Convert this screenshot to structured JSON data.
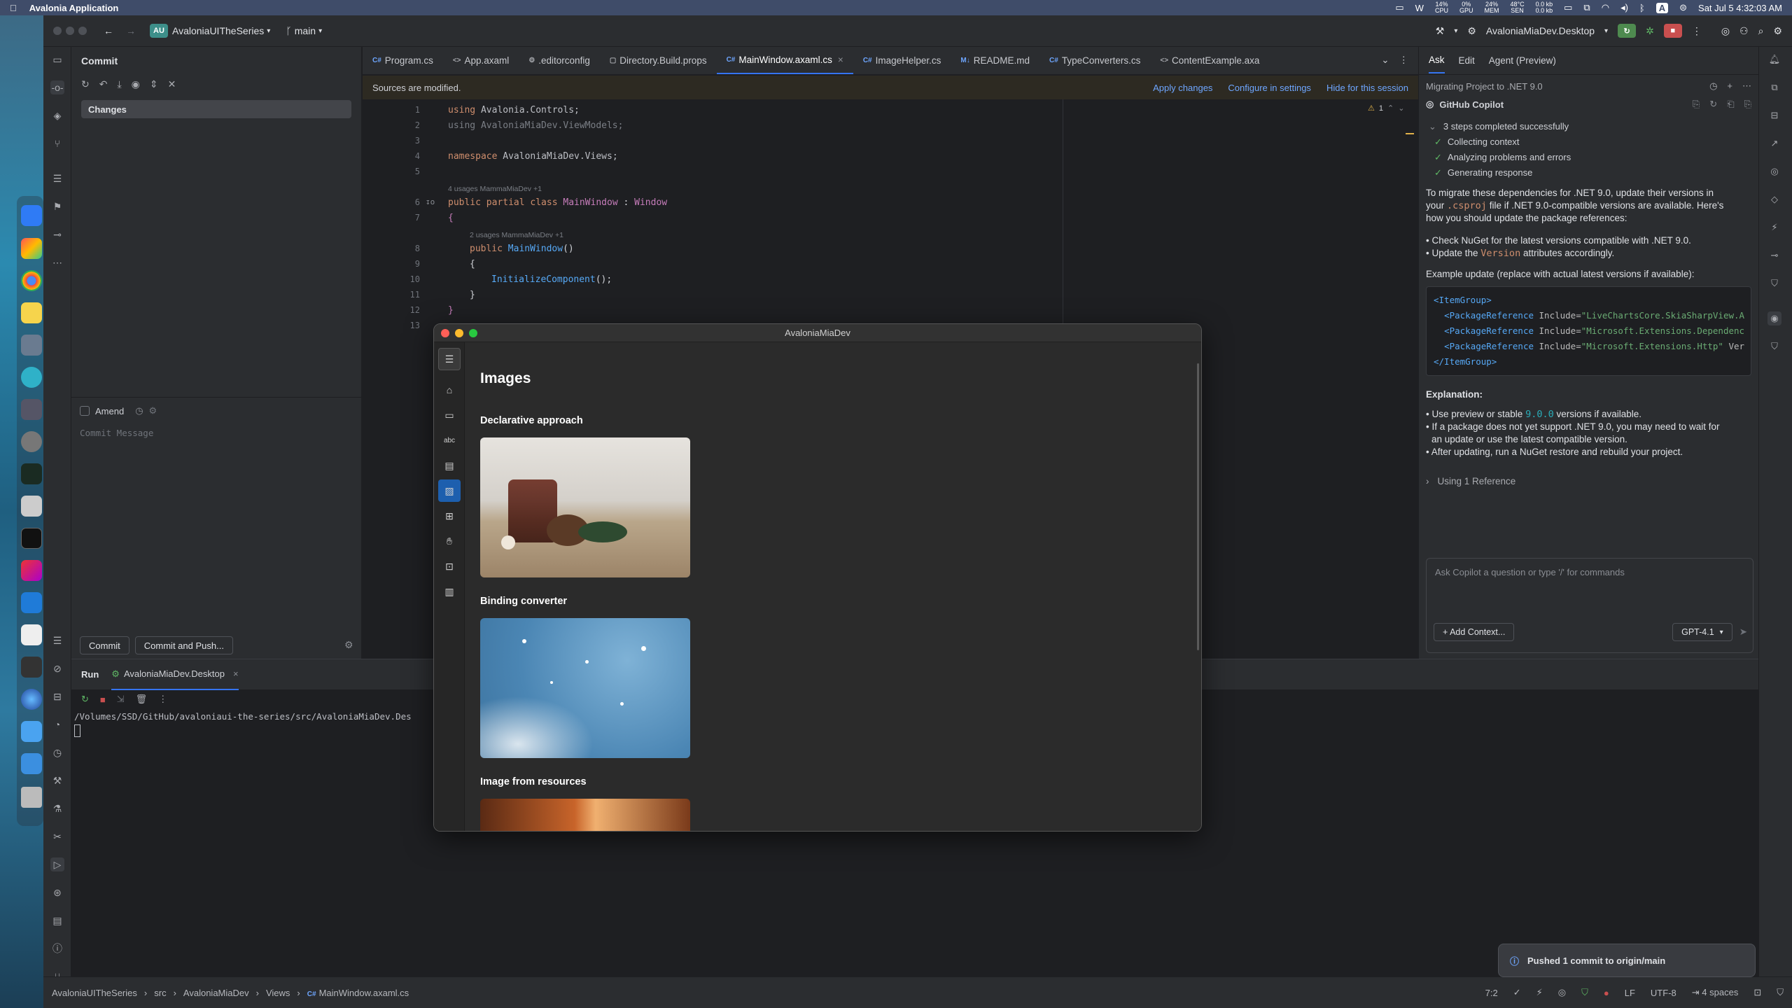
{
  "menubar": {
    "app_name": "Avalonia Application",
    "stats": [
      {
        "v": "14%",
        "l": "CPU"
      },
      {
        "v": "0%",
        "l": "GPU"
      },
      {
        "v": "24%",
        "l": "MEM"
      },
      {
        "v": "48°C",
        "l": "SEN"
      },
      {
        "v": "0.0 kb",
        "l": "0.0 kb"
      }
    ],
    "input_badge": "A",
    "datetime": "Sat Jul 5  4:32:03 AM"
  },
  "ide": {
    "project_badge": "AU",
    "project_name": "AvaloniaUITheSeries",
    "branch": "main",
    "run_config": "AvaloniaMiaDev.Desktop",
    "commit_panel": {
      "title": "Commit",
      "changes_label": "Changes",
      "amend_label": "Amend",
      "commit_message_placeholder": "Commit Message",
      "commit_button": "Commit",
      "commit_push_button": "Commit and Push..."
    },
    "tabs": [
      {
        "prefix": "C#",
        "label": "Program.cs",
        "color": "#6ea6ff"
      },
      {
        "prefix": "<>",
        "label": "App.axaml",
        "color": "#a9abb0"
      },
      {
        "prefix": "⚙",
        "label": ".editorconfig",
        "color": "#a9abb0"
      },
      {
        "prefix": "▢",
        "label": "Directory.Build.props",
        "color": "#a9abb0"
      },
      {
        "prefix": "C#",
        "label": "MainWindow.axaml.cs",
        "color": "#6ea6ff",
        "active": true
      },
      {
        "prefix": "C#",
        "label": "ImageHelper.cs",
        "color": "#6ea6ff"
      },
      {
        "prefix": "M↓",
        "label": "README.md",
        "color": "#6ea6ff"
      },
      {
        "prefix": "C#",
        "label": "TypeConverters.cs",
        "color": "#6ea6ff"
      },
      {
        "prefix": "<>",
        "label": "ContentExample.axa",
        "color": "#a9abb0"
      }
    ],
    "notice": {
      "text": "Sources are modified.",
      "apply": "Apply changes",
      "configure": "Configure in settings",
      "hide": "Hide for this session"
    },
    "warnings": "1",
    "code": {
      "line_numbers": [
        "1",
        "2",
        "3",
        "4",
        "5",
        "6",
        "7",
        "8",
        "9",
        "10",
        "11",
        "12",
        "13"
      ],
      "l1_kw": "using",
      "l1_ns": "Avalonia.Controls;",
      "l2": "using AvaloniaMiaDev.ViewModels;",
      "l4_kw": "namespace",
      "l4_ns": "AvaloniaMiaDev.Views;",
      "hint1_usages": "4 usages",
      "hint1_author": "MammaMiaDev +1",
      "l6_kw": "public partial class",
      "l6_ty": "MainWindow",
      "l6_sep": " : ",
      "l6_base": "Window",
      "l7": "{",
      "hint2_usages": "2 usages",
      "hint2_author": "MammaMiaDev +1",
      "l8_kw": "public",
      "l8_fn": "MainWindow",
      "l8_rest": "()",
      "l9": "{",
      "l10_fn": "InitializeComponent",
      "l10_rest": "();",
      "l11": "}",
      "l12": "}"
    },
    "copilot": {
      "tabs": [
        "Ask",
        "Edit",
        "Agent (Preview)"
      ],
      "session_title": "Migrating Project to .NET 9.0",
      "author": "GitHub Copilot",
      "steps_summary": "3 steps completed successfully",
      "steps": [
        "Collecting context",
        "Analyzing problems and errors",
        "Generating response"
      ],
      "intro_1": "To migrate these dependencies for .NET 9.0, update their versions in",
      "intro_2a": "your",
      "intro_2code": ".csproj",
      "intro_2b": "file if .NET 9.0-compatible versions are available. Here's",
      "intro_3": "how you should update the package references:",
      "bullet_1": "• Check NuGet for the latest versions compatible with .NET 9.0.",
      "bullet_2a": "• Update the",
      "bullet_2code": "Version",
      "bullet_2b": "attributes accordingly.",
      "example_label": "Example update (replace with actual latest versions if available):",
      "code_open": "<ItemGroup>",
      "pkg_tag": "<PackageReference",
      "pkg_attr": "Include=",
      "pkg_1": "\"LiveChartsCore.SkiaSharpView.A",
      "pkg_2": "\"Microsoft.Extensions.Dependenc",
      "pkg_3": "\"Microsoft.Extensions.Http\"",
      "pkg_3_tail": "Ver",
      "code_close": "</ItemGroup>",
      "explanation_title": "Explanation:",
      "exp_1a": "• Use preview or stable",
      "exp_1code": "9.0.0",
      "exp_1b": "versions if available.",
      "exp_2a": "• If a package does not yet support .NET 9.0, you may need to wait for",
      "exp_2b": "an update or use the latest compatible version.",
      "exp_3": "• After updating, run a NuGet restore and rebuild your project.",
      "reference": "Using 1 Reference",
      "input_placeholder": "Ask Copilot a question or type '/' for commands",
      "add_context": "+ Add Context...",
      "model": "GPT-4.1"
    },
    "run": {
      "tab_label": "Run",
      "config_tab": "AvaloniaMiaDev.Desktop",
      "output_path": "/Volumes/SSD/GitHub/avaloniaui-the-series/src/AvaloniaMiaDev.Des"
    },
    "status": {
      "breadcrumbs": [
        "AvaloniaUITheSeries",
        "src",
        "AvaloniaMiaDev",
        "Views",
        "MainWindow.axaml.cs"
      ],
      "position": "7:2",
      "line_ending": "LF",
      "encoding": "UTF-8",
      "indent": "4 spaces"
    },
    "toast": "Pushed 1 commit to origin/main"
  },
  "app": {
    "window_title": "AvaloniaMiaDev",
    "page_title": "Images",
    "sections": [
      "Declarative approach",
      "Binding converter",
      "Image from resources"
    ]
  }
}
